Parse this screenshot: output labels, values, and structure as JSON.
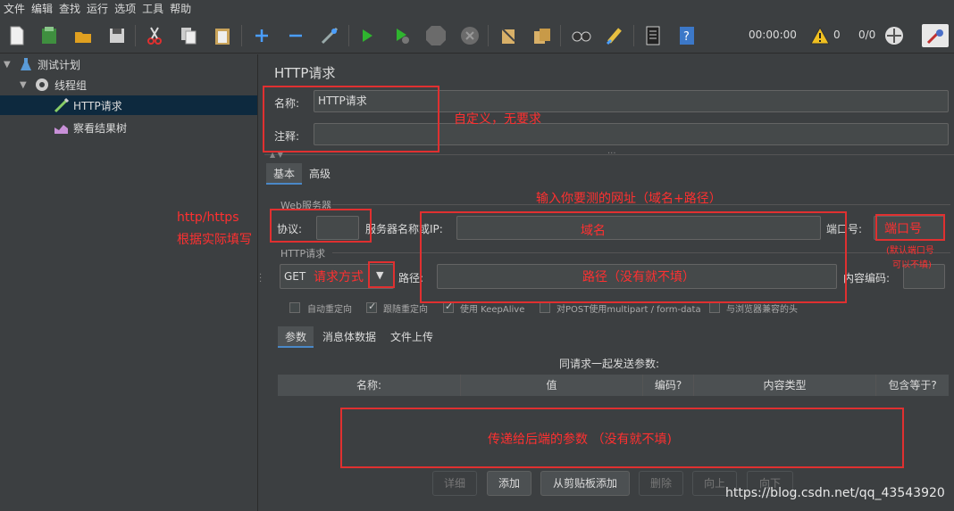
{
  "menu": [
    "文件",
    "编辑",
    "查找",
    "运行",
    "选项",
    "工具",
    "帮助"
  ],
  "toolbar": {
    "timer": "00:00:00",
    "warning_count": "0",
    "thread_ratio": "0/0"
  },
  "tree": [
    {
      "label": "测试计划",
      "icon": "flask-icon"
    },
    {
      "label": "线程组",
      "icon": "gear-icon"
    },
    {
      "label": "HTTP请求",
      "icon": "pipette-icon"
    },
    {
      "label": "察看结果树",
      "icon": "chart-icon"
    }
  ],
  "panel": {
    "title": "HTTP请求",
    "name_label": "名称:",
    "name_value": "HTTP请求",
    "comment_label": "注释:",
    "comment_value": "",
    "tabs": [
      "基本",
      "高级"
    ],
    "web_server_section": "Web服务器",
    "protocol_label": "协议:",
    "protocol_value": "",
    "server_label": "服务器名称或IP:",
    "server_value": "",
    "port_label": "端口号:",
    "port_value": "",
    "http_section": "HTTP请求",
    "method_value": "GET",
    "path_label": "路径:",
    "path_value": "",
    "encoding_label": "内容编码:",
    "encoding_value": "",
    "checkboxes": [
      {
        "label": "自动重定向",
        "checked": false
      },
      {
        "label": "跟随重定向",
        "checked": true
      },
      {
        "label": "使用 KeepAlive",
        "checked": true
      },
      {
        "label": "对POST使用multipart / form-data",
        "checked": false
      },
      {
        "label": "与浏览器兼容的头",
        "checked": false
      }
    ],
    "subtabs": [
      "参数",
      "消息体数据",
      "文件上传"
    ],
    "params_caption": "同请求一起发送参数:",
    "columns": [
      "名称:",
      "值",
      "编码?",
      "内容类型",
      "包含等于?"
    ],
    "buttons": [
      "详细",
      "添加",
      "从剪贴板添加",
      "删除",
      "向上",
      "向下"
    ]
  },
  "annotations": {
    "name_note": "自定义，无要求",
    "url_note": "输入你要测的网址（域名+路径）",
    "protocol_note_1": "http/https",
    "protocol_note_2": "根据实际填写",
    "domain_note": "域名",
    "port_note": "端口号",
    "port_default_1": "(默认端口号",
    "port_default_2": "可以不填)",
    "method_note": "请求方式",
    "path_note": "路径（没有就不填）",
    "params_note": "传递给后端的参数 （没有就不填)"
  },
  "watermark": "https://blog.csdn.net/qq_43543920"
}
